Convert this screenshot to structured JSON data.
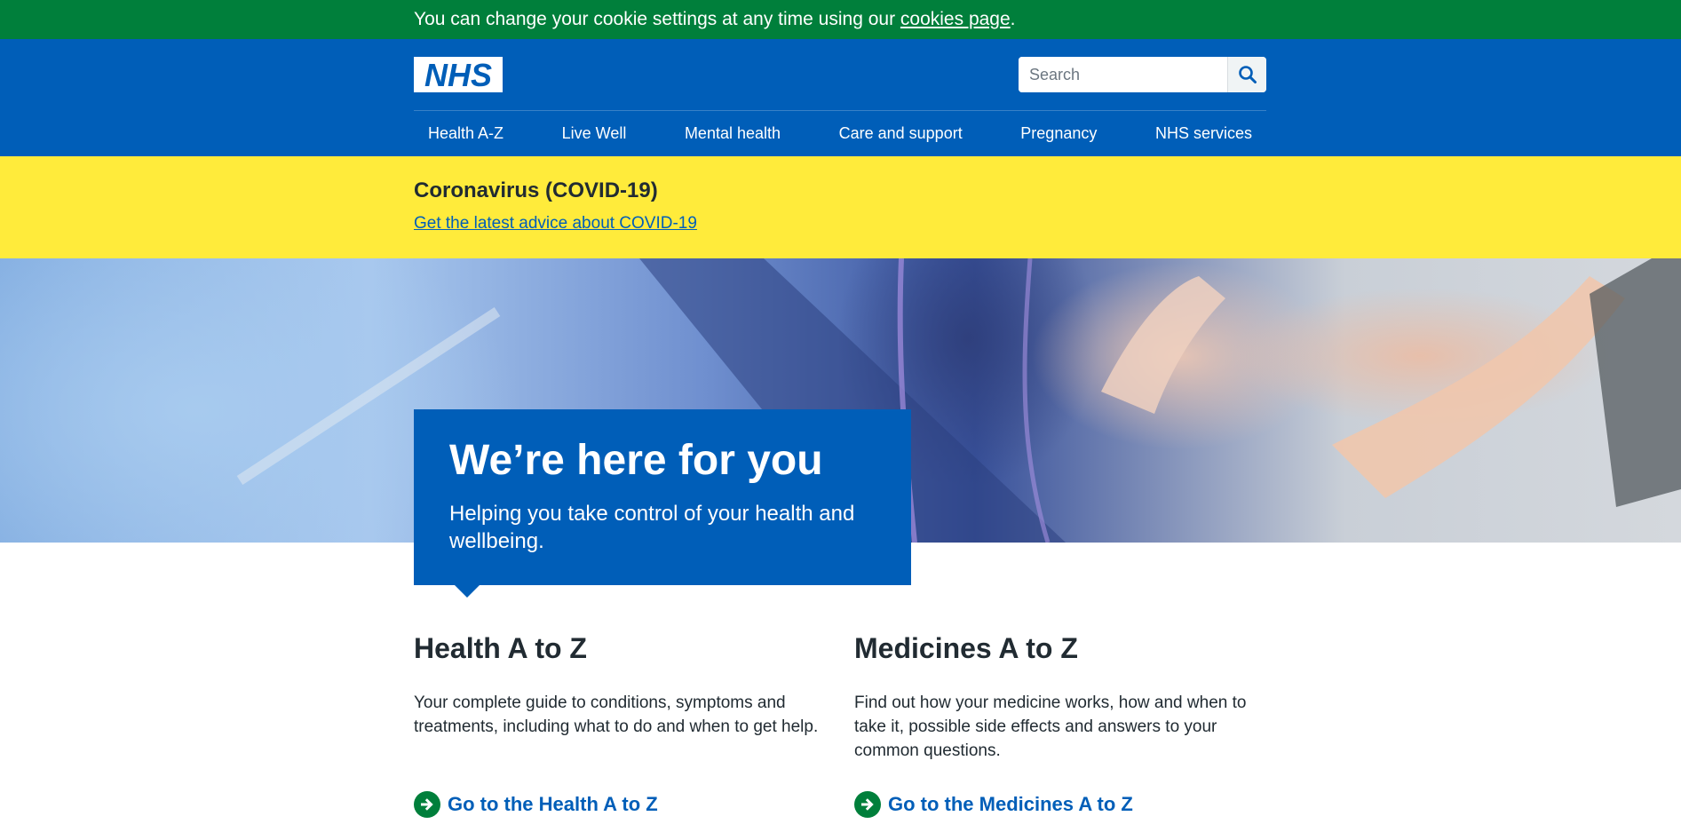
{
  "cookie_banner": {
    "text_before": "You can change your cookie settings at any time using our ",
    "link_text": "cookies page",
    "text_after": "."
  },
  "header": {
    "logo_text": "NHS",
    "search_placeholder": "Search",
    "nav_items": [
      {
        "label": "Health A-Z"
      },
      {
        "label": "Live Well"
      },
      {
        "label": "Mental health"
      },
      {
        "label": "Care and support"
      },
      {
        "label": "Pregnancy"
      },
      {
        "label": "NHS services"
      }
    ]
  },
  "covid_banner": {
    "title": "Coronavirus (COVID-19)",
    "link": "Get the latest advice about COVID-19"
  },
  "hero": {
    "title": "We’re here for you",
    "lead": "Helping you take control of your health and wellbeing."
  },
  "cards": [
    {
      "title": "Health A to Z",
      "body": "Your complete guide to conditions, symptoms and treatments, including what to do and when to get help.",
      "action": "Go to the Health A to Z"
    },
    {
      "title": "Medicines A to Z",
      "body": "Find out how your medicine works, how and when to take it, possible side effects and answers to your common questions.",
      "action": "Go to the Medicines A to Z"
    }
  ],
  "colors": {
    "nhs_blue": "#005eb8",
    "cookie_green": "#007f3b",
    "alert_yellow": "#ffeb3b",
    "text": "#212b32",
    "action_green": "#007f3b"
  },
  "icons": {
    "search": "search-icon",
    "action_arrow": "arrow-right-circle-icon"
  }
}
